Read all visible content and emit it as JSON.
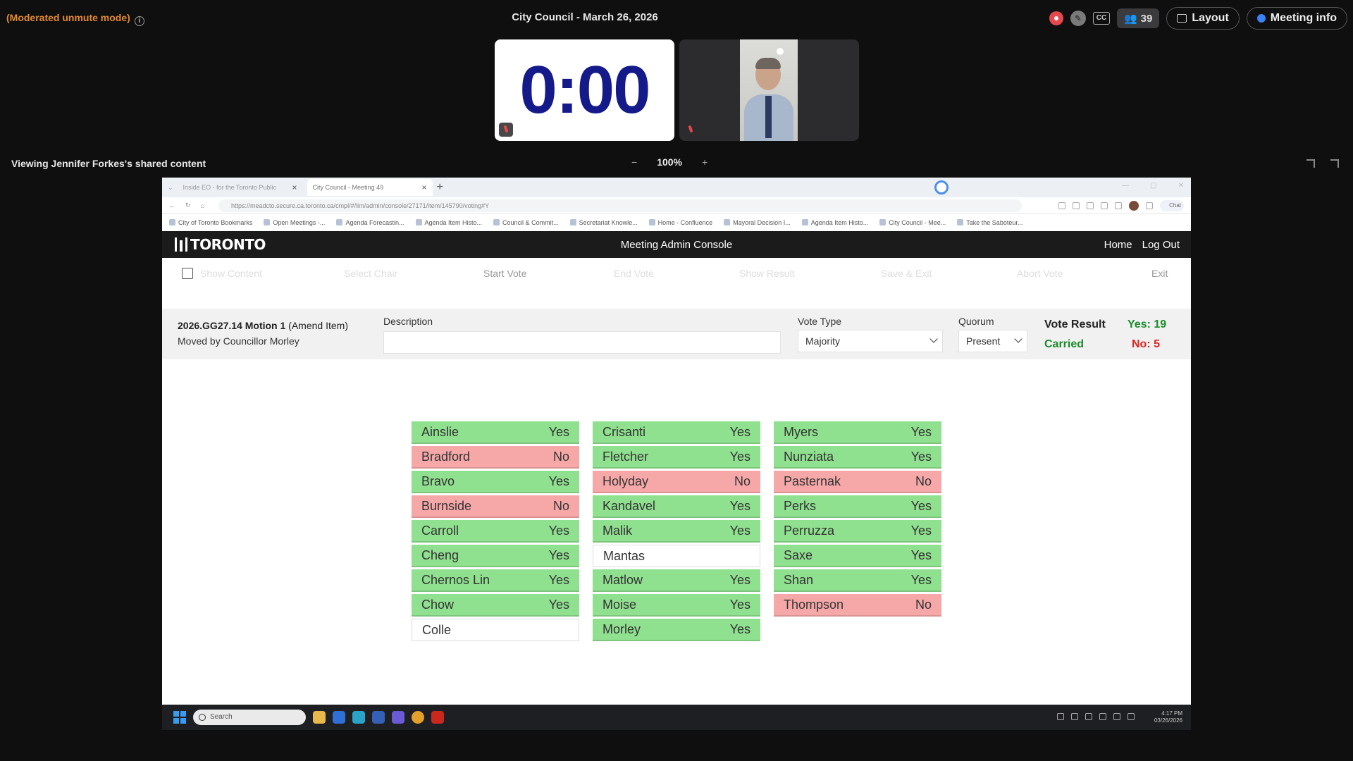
{
  "meeting": {
    "mode_label": "(Moderated unmute mode)",
    "title": "City Council - March 26, 2026",
    "participants": "39",
    "layout_label": "Layout",
    "info_label": "Meeting info",
    "timer": "0:00",
    "viewing_label": "Viewing Jennifer Forkes's shared content",
    "zoom_level": "100%",
    "zoom_out": "−",
    "zoom_in": "+"
  },
  "browser": {
    "tabs": [
      {
        "label": "Inside EO - for the Toronto Public"
      },
      {
        "label": "City Council - Meeting 49"
      }
    ],
    "url": "https://meadcto.secure.ca.toronto.ca/cmpl/#/lim/admin/console/27171/item/145790/voting#Y",
    "bookmarks": [
      "City of Toronto Bookmarks",
      "Open Meetings -...",
      "Agenda Forecastin...",
      "Agenda Item Histo...",
      "Council & Commit...",
      "Secretariat Knowle...",
      "Home - Confluence",
      "Mayoral Decision I...",
      "Agenda Item Histo...",
      "City Council - Mee...",
      "Take the Saboteur..."
    ],
    "chat_label": "Chat"
  },
  "app": {
    "logo": "TORONTO",
    "title": "Meeting Admin Console",
    "nav_home": "Home",
    "nav_logout": "Log Out",
    "toolbar": {
      "show_content": "Show Content",
      "select_chair": "Select Chair",
      "start_vote": "Start Vote",
      "end_vote": "End Vote",
      "show_result": "Show Result",
      "save_exit": "Save & Exit",
      "abort_vote": "Abort Vote",
      "exit": "Exit"
    },
    "motion": {
      "id": "2026.GG27.14 Motion 1",
      "type": " (Amend Item)",
      "moved_by": "Moved by Councillor Morley"
    },
    "description_label": "Description",
    "description_value": "",
    "vote_type_label": "Vote Type",
    "vote_type_value": "Majority",
    "quorum_label": "Quorum",
    "quorum_value": "Present",
    "vote_result_label": "Vote Result",
    "vote_result_status": "Carried",
    "yes_count": "Yes: 19",
    "no_count": "No: 5"
  },
  "votes": [
    [
      {
        "name": "Ainslie",
        "vote": "Yes"
      },
      {
        "name": "Bradford",
        "vote": "No"
      },
      {
        "name": "Bravo",
        "vote": "Yes"
      },
      {
        "name": "Burnside",
        "vote": "No"
      },
      {
        "name": "Carroll",
        "vote": "Yes"
      },
      {
        "name": "Cheng",
        "vote": "Yes"
      },
      {
        "name": "Chernos Lin",
        "vote": "Yes"
      },
      {
        "name": "Chow",
        "vote": "Yes"
      },
      {
        "name": "Colle",
        "vote": ""
      }
    ],
    [
      {
        "name": "Crisanti",
        "vote": "Yes"
      },
      {
        "name": "Fletcher",
        "vote": "Yes"
      },
      {
        "name": "Holyday",
        "vote": "No"
      },
      {
        "name": "Kandavel",
        "vote": "Yes"
      },
      {
        "name": "Malik",
        "vote": "Yes"
      },
      {
        "name": "Mantas",
        "vote": ""
      },
      {
        "name": "Matlow",
        "vote": "Yes"
      },
      {
        "name": "Moise",
        "vote": "Yes"
      },
      {
        "name": "Morley",
        "vote": "Yes"
      }
    ],
    [
      {
        "name": "Myers",
        "vote": "Yes"
      },
      {
        "name": "Nunziata",
        "vote": "Yes"
      },
      {
        "name": "Pasternak",
        "vote": "No"
      },
      {
        "name": "Perks",
        "vote": "Yes"
      },
      {
        "name": "Perruzza",
        "vote": "Yes"
      },
      {
        "name": "Saxe",
        "vote": "Yes"
      },
      {
        "name": "Shan",
        "vote": "Yes"
      },
      {
        "name": "Thompson",
        "vote": "No"
      }
    ]
  ],
  "taskbar": {
    "search_placeholder": "Search",
    "time": "4:17 PM",
    "date": "03/26/2026"
  },
  "colors": {
    "yes": "#8fe08f",
    "no": "#f6a8a8",
    "carried": "#1a8a2a",
    "no_count": "#e0261f",
    "timer": "#141a8a",
    "moderated": "#e58a2a"
  }
}
